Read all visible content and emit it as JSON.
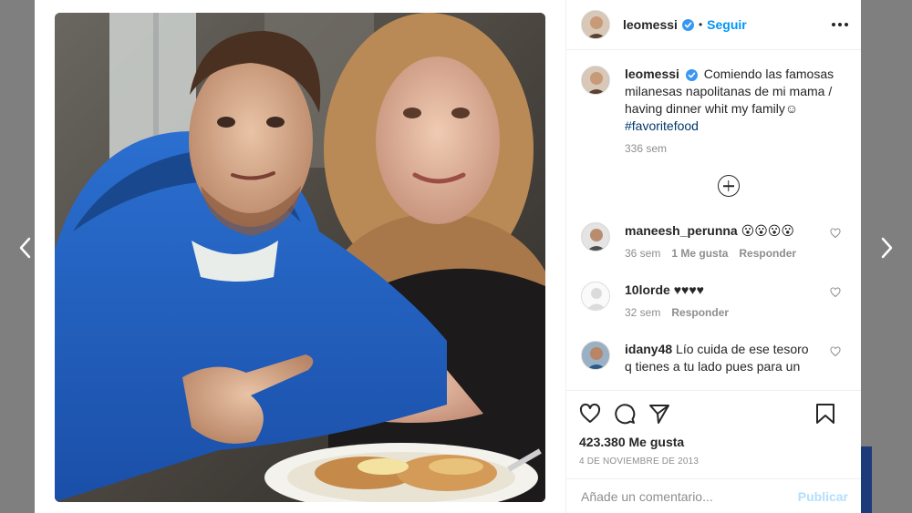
{
  "post": {
    "username": "leomessi",
    "follow_label": "Seguir",
    "separator": "•",
    "caption_user": "leomessi",
    "caption_text": "Comiendo las famosas milanesas napolitanas de mi mama / having dinner whit my family☺",
    "caption_hashtag": "#favoritefood",
    "caption_time": "336 sem",
    "likes": "423.380 Me gusta",
    "date": "4 de noviembre de 2013",
    "comment_placeholder": "Añade un comentario...",
    "publish_label": "Publicar"
  },
  "comments": [
    {
      "user": "maneesh_perunna",
      "text": "😮😮😮😮",
      "time": "36 sem",
      "likes": "1 Me gusta",
      "reply": "Responder"
    },
    {
      "user": "10lorde",
      "text": "♥♥♥♥",
      "time": "32 sem",
      "likes": "",
      "reply": "Responder"
    },
    {
      "user": "idany48",
      "text": "Lío cuida de ese tesoro q tienes a tu lado pues para un",
      "time": "",
      "likes": "",
      "reply": ""
    }
  ],
  "icons": {
    "prev": "chevron-left-icon",
    "next": "chevron-right-icon",
    "more": "more-options-icon",
    "verified": "verified-badge-icon",
    "load_more": "plus-circle-icon",
    "like": "heart-icon",
    "comment": "comment-icon",
    "share": "send-icon",
    "save": "bookmark-icon"
  },
  "colors": {
    "accent": "#0095f6",
    "verified": "#3897f0",
    "backdrop": "#7f7f7f",
    "publish_disabled": "#b2dffc"
  }
}
